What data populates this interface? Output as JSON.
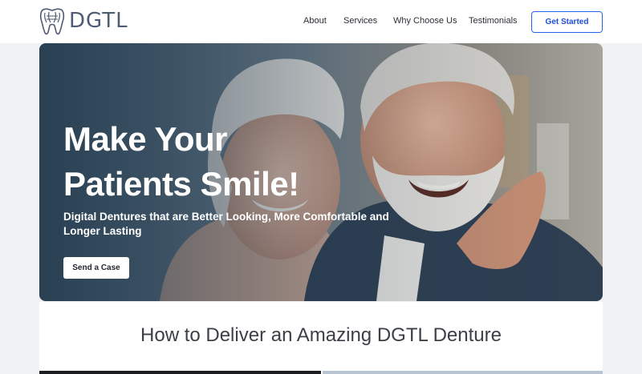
{
  "header": {
    "logo_text": "DGTL",
    "nav": [
      "About",
      "Services",
      "Why Choose Us",
      "Testimonials"
    ],
    "cta_label": "Get Started"
  },
  "hero": {
    "title_line1": "Make Your",
    "title_line2": "Patients Smile!",
    "subtitle": "Digital Dentures that are Better Looking, More Comfortable and Longer Lasting",
    "button_label": "Send a Case",
    "image": "smiling-senior-couple-photo"
  },
  "section": {
    "title": "How to Deliver an Amazing DGTL Denture"
  },
  "colors": {
    "accent": "#2563eb",
    "logo": "#4e5b73",
    "hero_text": "#ffffff"
  }
}
